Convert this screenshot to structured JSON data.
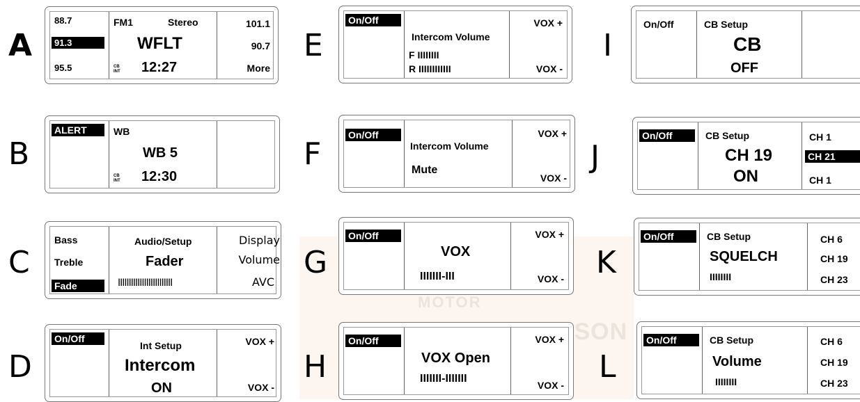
{
  "panels": {
    "A": {
      "letter": "A",
      "l1": "88.7",
      "l2": "91.3",
      "l3": "95.5",
      "m1a": "FM1",
      "m1b": "Stereo",
      "m2": "WFLT",
      "tag": "CB\nINT",
      "m3": "12:27",
      "r1": "101.1",
      "r2": "90.7",
      "r3": "More"
    },
    "B": {
      "letter": "B",
      "l1": "ALERT",
      "m1": "WB",
      "m2": "WB 5",
      "tag": "CB\nINT",
      "m3": "12:30"
    },
    "C": {
      "letter": "C",
      "l1": "Bass",
      "l2": "Treble",
      "l3": "Fade",
      "m1": "Audio/Setup",
      "m2": "Fader",
      "m3": "IIIIIIIIIIIIIIIIIIIIIIIII",
      "r1": "Display",
      "r2": "Volume",
      "r3": "AVC"
    },
    "D": {
      "letter": "D",
      "l1": "On/Off",
      "m1": "Int Setup",
      "m2": "Intercom",
      "m3": "ON",
      "r1": "VOX +",
      "r2": "VOX -"
    },
    "E": {
      "letter": "E",
      "l1": "On/Off",
      "m1": "Intercom Volume",
      "m2": "F IIIIIIII",
      "m3": "R IIIIIIIIIIII",
      "r1": "VOX +",
      "r2": "VOX -"
    },
    "F": {
      "letter": "F",
      "l1": "On/Off",
      "m1": "Intercom Volume",
      "m2": "Mute",
      "r1": "VOX +",
      "r2": "VOX -"
    },
    "G": {
      "letter": "G",
      "l1": "On/Off",
      "m1": "VOX",
      "m2": "IIIIIII-III",
      "r1": "VOX +",
      "r2": "VOX -"
    },
    "H": {
      "letter": "H",
      "l1": "On/Off",
      "m1": "VOX Open",
      "m2": "IIIIIII-IIIIIII",
      "r1": "VOX +",
      "r2": "VOX -"
    },
    "I": {
      "letter": "I",
      "l1": "On/Off",
      "m1": "CB Setup",
      "m2": "CB",
      "m3": "OFF"
    },
    "J": {
      "letter": "J",
      "l1": "On/Off",
      "m1": "CB Setup",
      "m2": "CH 19",
      "m3": "ON",
      "r1": "CH 1",
      "r2": "CH 21",
      "r3": "CH 1"
    },
    "K": {
      "letter": "K",
      "l1": "On/Off",
      "m1": "CB Setup",
      "m2": "SQUELCH",
      "m3": "IIIIIIII",
      "r1": "CH 6",
      "r2": "CH 19",
      "r3": "CH 23"
    },
    "L": {
      "letter": "L",
      "l1": "On/Off",
      "m1": "CB Setup",
      "m2": "Volume",
      "m3": "IIIIIIII",
      "r1": "CH 6",
      "r2": "CH 19",
      "r3": "CH 23"
    }
  },
  "watermark": {
    "line1": "MOTOR",
    "line2": "HARLEY-DAVIDSON"
  }
}
